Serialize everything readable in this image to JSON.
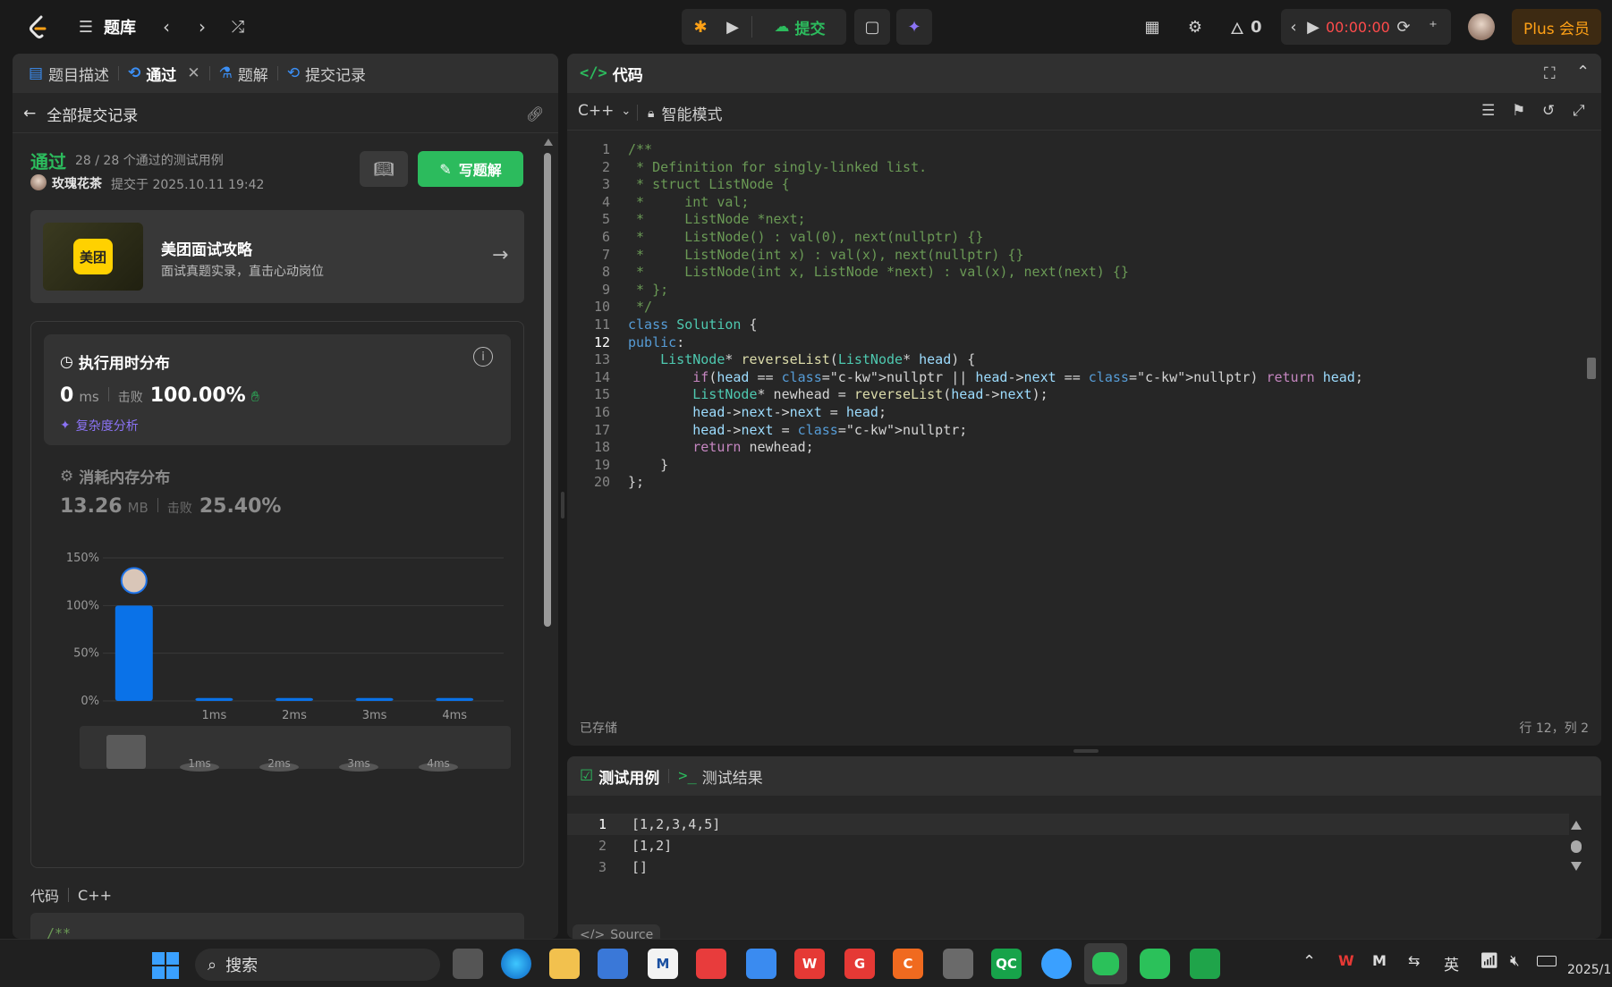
{
  "topbar": {
    "problem_bank": "题库",
    "submit_label": "提交",
    "streak_count": "0",
    "timer": "00:00:00",
    "plus_label": "Plus 会员"
  },
  "left_tabs": [
    {
      "label": "题目描述"
    },
    {
      "label": "通过"
    },
    {
      "label": "题解"
    },
    {
      "label": "提交记录"
    }
  ],
  "submission": {
    "back_label": "全部提交记录",
    "status": "通过",
    "passed_cases": "28 / 28 个通过的测试用例",
    "user": "玫瑰花茶",
    "submitted_at": "提交于 2025.10.11 19:42",
    "write_solution": "写题解"
  },
  "promo": {
    "logo_text": "美团",
    "title": "美团面试攻略",
    "subtitle": "面试真题实录，直击心动岗位"
  },
  "runtime": {
    "title": "执行用时分布",
    "value": "0",
    "unit": "ms",
    "beat_label": "击败",
    "beat_value": "100.00%",
    "complexity_link": "复杂度分析"
  },
  "memory": {
    "title": "消耗内存分布",
    "value": "13.26",
    "unit": "MB",
    "beat_label": "击败",
    "beat_value": "25.40%"
  },
  "chart_data": {
    "type": "bar",
    "categories": [
      "0ms",
      "1ms",
      "2ms",
      "3ms",
      "4ms"
    ],
    "x_tick_labels": [
      "",
      "1ms",
      "2ms",
      "3ms",
      "4ms"
    ],
    "values": [
      100,
      3,
      3,
      3,
      3
    ],
    "y_ticks": [
      "0%",
      "50%",
      "100%",
      "150%"
    ],
    "ylim": [
      0,
      150
    ],
    "highlight_index": 0,
    "bar_color": "#0a72e8",
    "mini_labels": [
      "1ms",
      "2ms",
      "3ms",
      "4ms"
    ]
  },
  "code_section": {
    "label": "代码",
    "lang": "C++",
    "preview": "/**"
  },
  "editor": {
    "title": "代码",
    "language": "C++",
    "mode": "智能模式",
    "saved": "已存储",
    "cursor": "行 12，列 2",
    "current_line": 12,
    "lines": [
      "/**",
      " * Definition for singly-linked list.",
      " * struct ListNode {",
      " *     int val;",
      " *     ListNode *next;",
      " *     ListNode() : val(0), next(nullptr) {}",
      " *     ListNode(int x) : val(x), next(nullptr) {}",
      " *     ListNode(int x, ListNode *next) : val(x), next(next) {}",
      " * };",
      " */",
      "class Solution {",
      "public:",
      "    ListNode* reverseList(ListNode* head) {",
      "        if(head == nullptr || head->next == nullptr) return head;",
      "        ListNode* newhead = reverseList(head->next);",
      "        head->next->next = head;",
      "        head->next = nullptr;",
      "        return newhead;",
      "    }",
      "};"
    ]
  },
  "testcase": {
    "tab_cases": "测试用例",
    "tab_results": "测试结果",
    "lines": [
      "[1,2,3,4,5]",
      "[1,2]",
      "[]"
    ],
    "source_label": "Source"
  },
  "taskbar": {
    "search_label": "搜索",
    "ime": "英",
    "clock": "2025/1"
  },
  "colors": {
    "accent_green": "#2cbb5d",
    "submit_green": "#2cbb5d",
    "plus_bg": "#3d2a12",
    "plus_fg": "#ffa116",
    "timer_red": "#ff4b4b",
    "link_purple": "#8b73f5"
  }
}
